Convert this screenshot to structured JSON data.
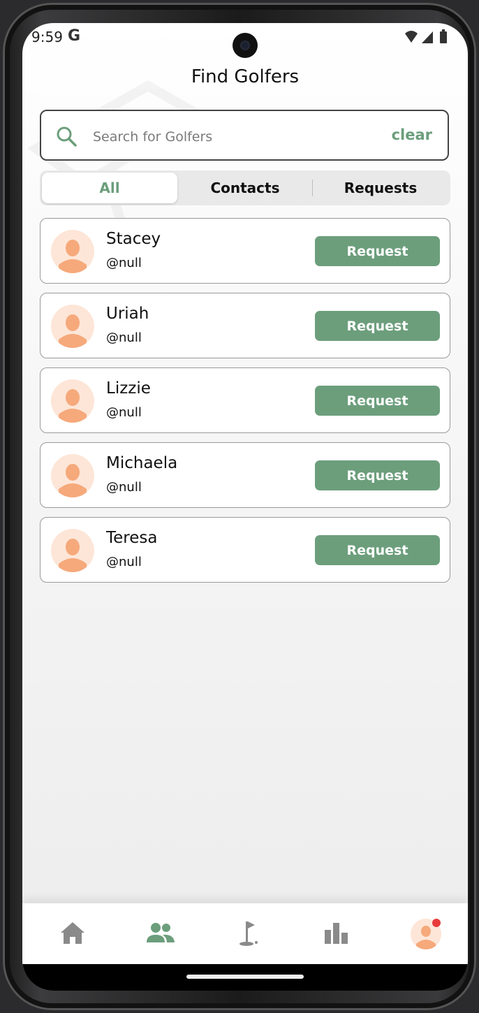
{
  "status_bar": {
    "time": "9:59",
    "g_label": "G",
    "icons": [
      "wifi-icon",
      "signal-icon",
      "battery-icon"
    ]
  },
  "header": {
    "title": "Find Golfers"
  },
  "search": {
    "placeholder": "Search for Golfers",
    "value": "",
    "clear_label": "clear"
  },
  "tabs": [
    {
      "label": "All",
      "active": true
    },
    {
      "label": "Contacts",
      "active": false
    },
    {
      "label": "Requests",
      "active": false
    }
  ],
  "golfers": [
    {
      "name": "Stacey",
      "handle": "@null",
      "action_label": "Request"
    },
    {
      "name": "Uriah",
      "handle": "@null",
      "action_label": "Request"
    },
    {
      "name": "Lizzie",
      "handle": "@null",
      "action_label": "Request"
    },
    {
      "name": "Michaela",
      "handle": "@null",
      "action_label": "Request"
    },
    {
      "name": "Teresa",
      "handle": "@null",
      "action_label": "Request"
    }
  ],
  "bottom_nav": {
    "items": [
      {
        "icon": "home-icon",
        "active": false
      },
      {
        "icon": "people-icon",
        "active": true
      },
      {
        "icon": "golf-flag-icon",
        "active": false
      },
      {
        "icon": "bar-chart-icon",
        "active": false
      },
      {
        "icon": "profile-avatar-icon",
        "active": false,
        "notification": true
      }
    ]
  },
  "colors": {
    "accent": "#6c9e7c",
    "avatar_bg": "#fde6d8",
    "avatar_fg": "#f6a97b",
    "nav_inactive": "#8a8a8a",
    "notification": "#e83a3a"
  }
}
